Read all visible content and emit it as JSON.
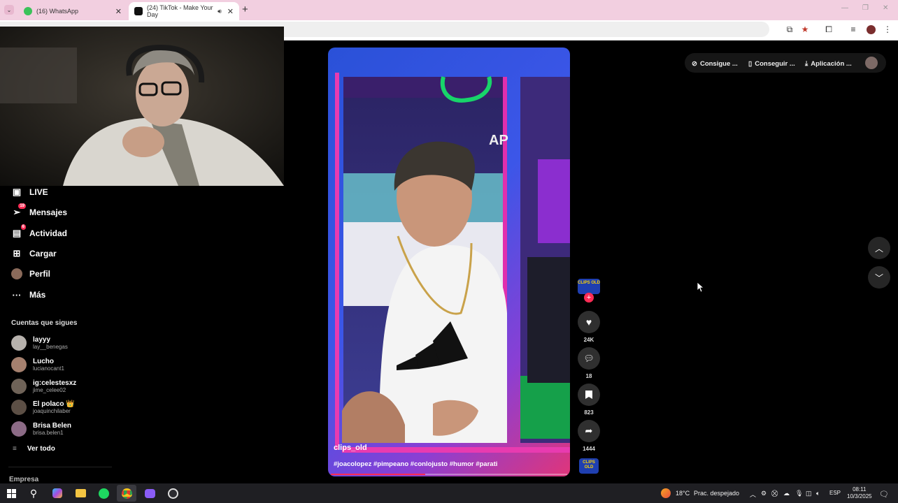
{
  "browser": {
    "tabs": [
      {
        "title": "(16) WhatsApp",
        "active": false,
        "icon": "whatsapp-icon"
      },
      {
        "title": "(24) TikTok - Make Your Day",
        "active": true,
        "icon": "tiktok-icon"
      }
    ]
  },
  "sidebar": {
    "nav": [
      {
        "label": "LIVE",
        "icon": "live-icon"
      },
      {
        "label": "Mensajes",
        "icon": "messages-icon",
        "badge": "19"
      },
      {
        "label": "Actividad",
        "icon": "activity-icon",
        "badge": "6"
      },
      {
        "label": "Cargar",
        "icon": "upload-icon"
      },
      {
        "label": "Perfil",
        "icon": "profile-avatar"
      },
      {
        "label": "Más",
        "icon": "more-icon"
      }
    ],
    "following_title": "Cuentas que sigues",
    "following": [
      {
        "name": "layyy",
        "handle": "lay__benegas"
      },
      {
        "name": "Lucho",
        "handle": "lucianocant1"
      },
      {
        "name": "ig:celestesxz",
        "handle": "jime_celee02"
      },
      {
        "name": "El polaco 👑",
        "handle": "joaquinchilaber"
      },
      {
        "name": "Brisa Belen",
        "handle": "brisa.belen1"
      }
    ],
    "see_all": "Ver todo",
    "footer": "Empresa"
  },
  "video": {
    "username": "clips_old",
    "caption": "#joacolopez #pimpeano #conlojusto #humor #parati",
    "overlay_text": "AP",
    "progress": 0.4
  },
  "actions": {
    "likes": "24K",
    "comments": "18",
    "saves": "823",
    "shares": "1444",
    "avatar_text": "CLIPS OLD"
  },
  "topbar": {
    "coins": "Consigue ...",
    "get": "Conseguir ...",
    "app": "Aplicación ..."
  },
  "taskbar": {
    "weather": "18°C",
    "weather_desc": "Prac. despejado",
    "lang": "ESP",
    "time": "08:11",
    "date": "10/3/2025"
  },
  "colors": {
    "accent": "#fe2c55",
    "tab_strip": "#f2cfe0",
    "video_gradient_start": "#2a51d8",
    "video_gradient_end": "#e0357a"
  }
}
